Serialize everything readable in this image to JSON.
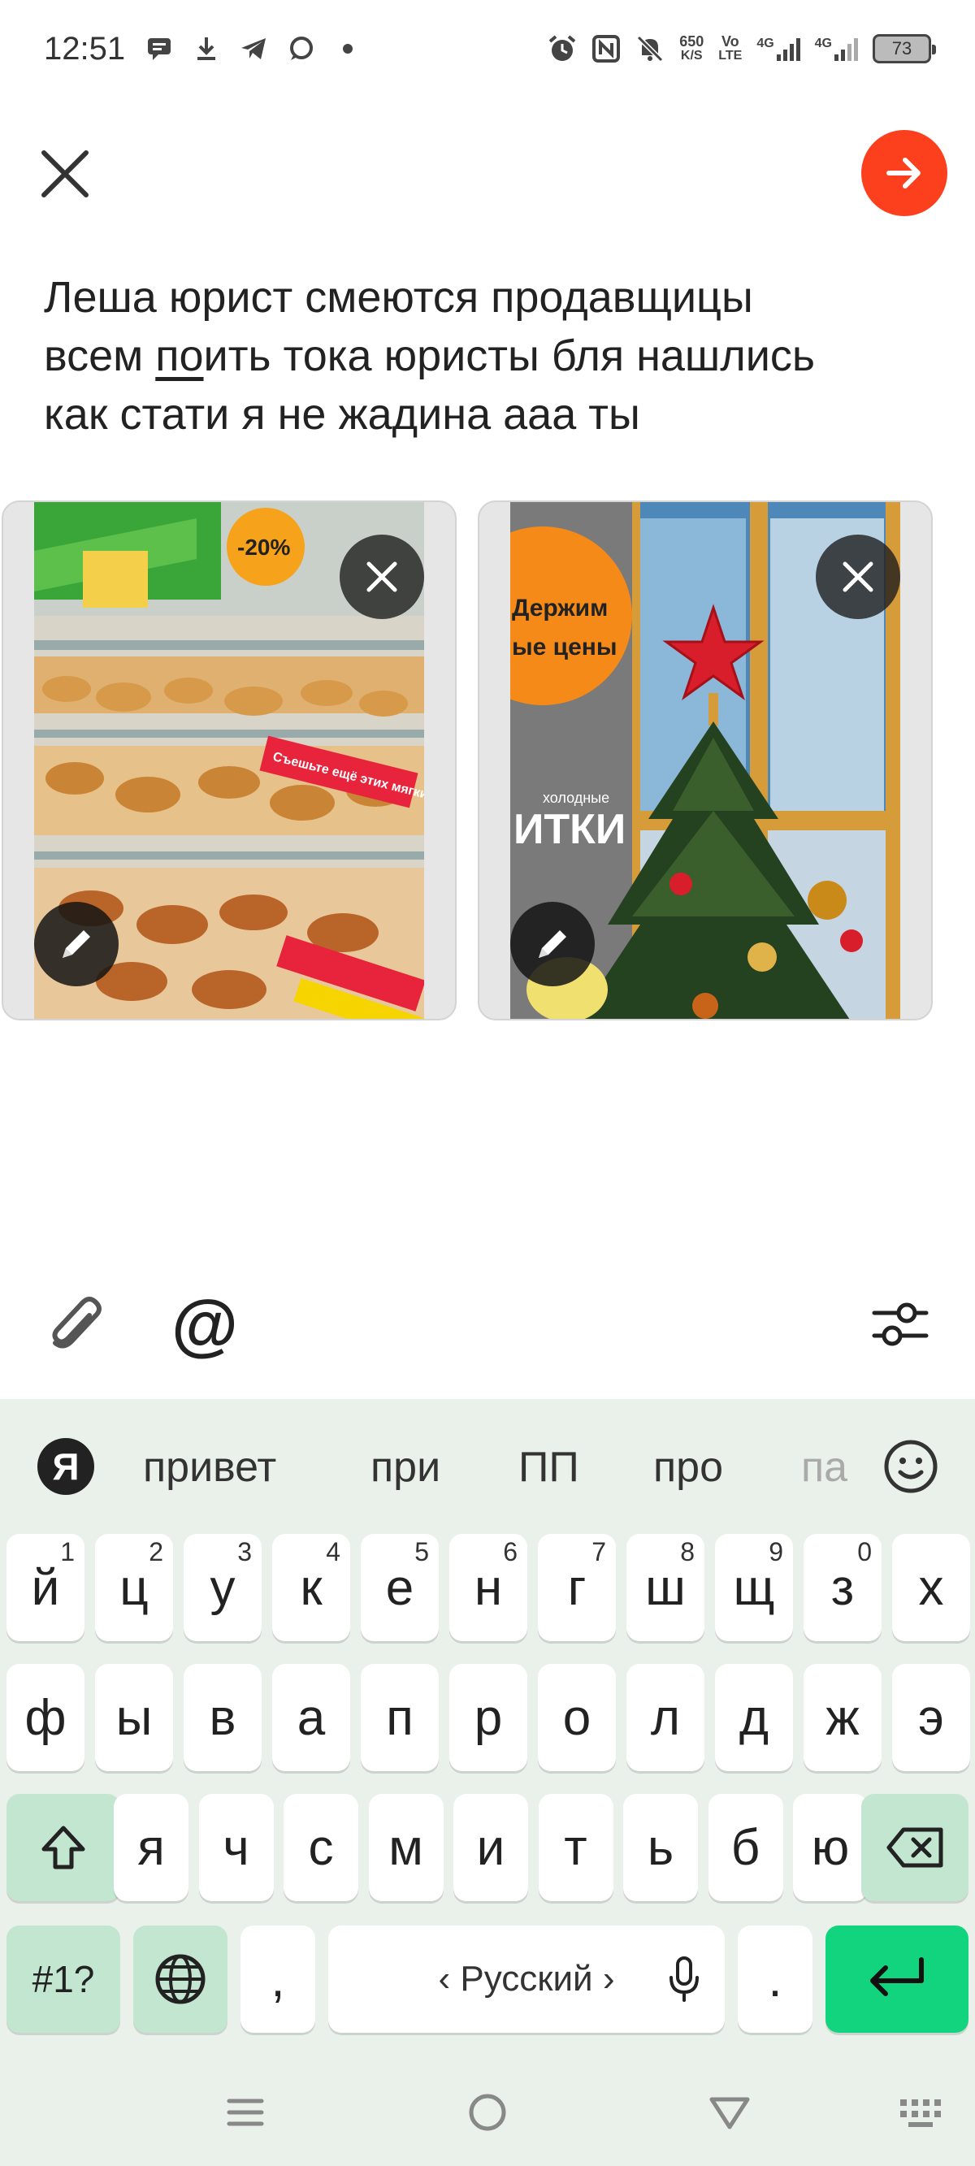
{
  "status_bar": {
    "time": "12:51",
    "net_speed_value": "650",
    "net_speed_unit": "K/S",
    "volte_top": "Vo",
    "volte_bottom": "LTE",
    "sim1": "4G",
    "sim2": "4G",
    "battery": "73"
  },
  "compose": {
    "message_line1": "Леша юрист смеются продавщицы",
    "message_line2_pre": "всем ",
    "message_line2_underlined": "по",
    "message_line2_post": "ить тока юристы бля нашлись",
    "message_line3": "как стати я не жадина ааа ты",
    "photo1_sign_top": "-20%",
    "photo1_sign_bottom": "Съешьте ещё этих мягких",
    "photo2_sign_top": "Держим",
    "photo2_sign_mid": "ые цены",
    "photo2_sign_bottom": "ИТКИ",
    "photo2_sign_small": "холодные"
  },
  "keyboard": {
    "brand": "Я",
    "suggestions": [
      "привет",
      "при",
      "ПП",
      "про",
      "па"
    ],
    "row1": [
      {
        "l": "й",
        "n": "1"
      },
      {
        "l": "ц",
        "n": "2"
      },
      {
        "l": "у",
        "n": "3"
      },
      {
        "l": "к",
        "n": "4"
      },
      {
        "l": "е",
        "n": "5"
      },
      {
        "l": "н",
        "n": "6"
      },
      {
        "l": "г",
        "n": "7"
      },
      {
        "l": "ш",
        "n": "8"
      },
      {
        "l": "щ",
        "n": "9"
      },
      {
        "l": "з",
        "n": "0"
      },
      {
        "l": "х",
        "n": ""
      }
    ],
    "row2": [
      "ф",
      "ы",
      "в",
      "а",
      "п",
      "р",
      "о",
      "л",
      "д",
      "ж",
      "э"
    ],
    "row3": [
      "я",
      "ч",
      "с",
      "м",
      "и",
      "т",
      "ь",
      "б",
      "ю"
    ],
    "symbols": "#1?",
    "comma": ",",
    "space_label": "‹ Русский ›",
    "period": "."
  },
  "colors": {
    "accent": "#fc3f1d",
    "keyboard_bg": "#e9f1ea",
    "func_key": "#c2e6d0",
    "enter_key": "#12d47f"
  }
}
